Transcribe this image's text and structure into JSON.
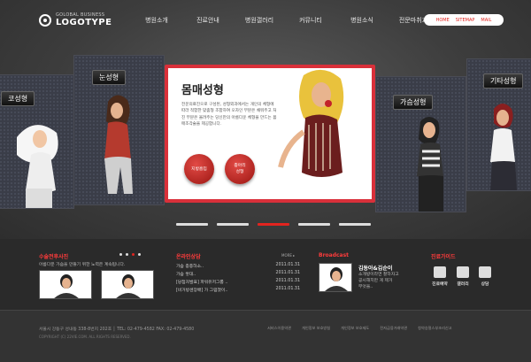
{
  "header": {
    "logo_sub": "GOLOBAL BUSINESS",
    "logo_main": "LOGOTYPE",
    "nav": [
      "병원소개",
      "진료안내",
      "병원갤러리",
      "커뮤니티",
      "병원소식",
      "전문마취과"
    ],
    "util": [
      "HOME",
      "SITEMAP",
      "MAIL"
    ]
  },
  "slider": {
    "panels": [
      "코성형",
      "눈성형",
      "가슴성형",
      "기타성형"
    ],
    "card": {
      "title": "몸매성형",
      "text": "전문의료진으로 구성된, 성형외과에서는 개인의 체형에 따라 적합한 맞춤형 조합하여 오자인 부분은 채워주고 처진 부분은 올려주는 당신만의 아름다운 체형을 만드는 몸매조각술을 제공합니다.",
      "btn1": "지방흡입",
      "btn2": "종아리\n성형"
    },
    "indicators": 5,
    "active_indicator": 2
  },
  "sections": {
    "surgery": {
      "title": "수술전후사진",
      "sub": "아름다운 가슴을 만들기 위한 노력은 계속됩니다."
    },
    "online": {
      "title": "온라인상담",
      "more": "MORE ▸",
      "items": [
        {
          "text": "가슴 종종하소..",
          "date": "2011.01.31"
        },
        {
          "text": "가슴 쌓대..",
          "date": "2011.01.31"
        },
        {
          "text": "[당첨자발표] 파워유저그룹 ..",
          "date": "2011.01.31"
        },
        {
          "text": "[비거방센장배] 가 그럼쳤이..",
          "date": "2011.01.31"
        }
      ]
    },
    "broadcast": {
      "title": "Broadcast",
      "name": "김동아&김순이",
      "desc": "소개방이라면 잘하자고\n공시해치만 게 제거\n무엇을.."
    },
    "guide": {
      "title": "진료가이드",
      "items": [
        "진료예약",
        "갤러리",
        "상담"
      ]
    }
  },
  "footer": {
    "address": "서울시 강동구 성내동 338-8번지 202호 │ TEL: 02-479-4582  FAX: 02-479-4580",
    "copyright": "COPYRIGHT (C) 22VIE.COM. ALL RIGHTS RESERVED.",
    "links": [
      "서비스이용약관",
      "개인정보 보호방침",
      "개인정보 보호제도",
      "전자금융거래약관",
      "청약승절스부조리신고"
    ]
  },
  "colors": {
    "accent": "#e2241f",
    "dark": "#2a2a2a"
  }
}
